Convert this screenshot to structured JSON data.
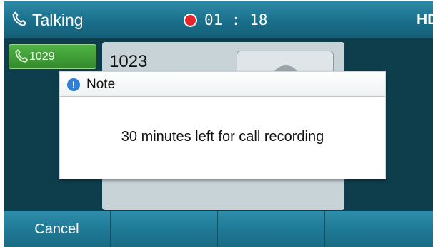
{
  "status_bar": {
    "title": "Talking",
    "phone_icon": "phone-icon",
    "record_icon": "recording-dot-icon",
    "timer": "01 : 18",
    "hd_label": "HD",
    "colors": {
      "background": "#1a6f8a",
      "record": "#e4262d"
    }
  },
  "line_key": {
    "label": "1029",
    "icon": "phone-icon",
    "color": "#4fb345"
  },
  "call": {
    "number": "1023",
    "avatar_icon": "contact-avatar-icon"
  },
  "dialog": {
    "title": "Note",
    "icon": "info-icon",
    "icon_glyph": "!",
    "message": "30 minutes left for call recording"
  },
  "softkeys": [
    {
      "label": "Cancel"
    },
    {
      "label": ""
    },
    {
      "label": ""
    },
    {
      "label": ""
    }
  ]
}
